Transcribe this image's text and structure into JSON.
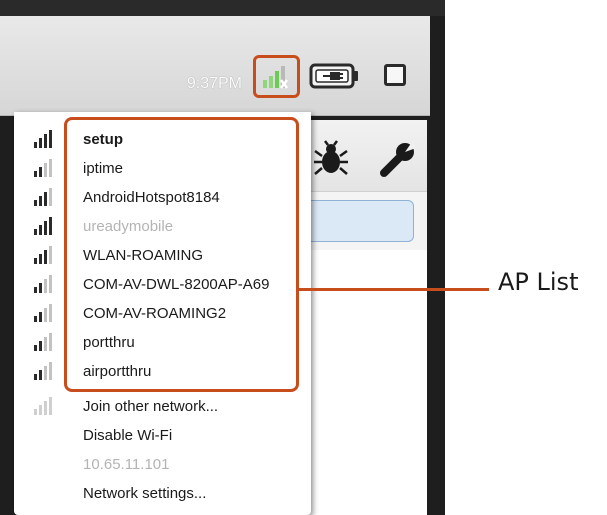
{
  "status_bar": {
    "time": "9:37PM",
    "icons": [
      "wifi-disconnected-icon",
      "battery-charging-icon",
      "square-icon"
    ]
  },
  "app": {
    "toolbar_icons": [
      "bug-icon",
      "wrench-icon"
    ]
  },
  "network_menu": {
    "networks": [
      {
        "name": "setup",
        "signal": 4,
        "bold": true
      },
      {
        "name": "iptime",
        "signal": 2
      },
      {
        "name": "AndroidHotspot8184",
        "signal": 3
      },
      {
        "name": "ureadymobile",
        "signal": 4,
        "disabled": true
      },
      {
        "name": "WLAN-ROAMING",
        "signal": 3
      },
      {
        "name": "COM-AV-DWL-8200AP-A69",
        "signal": 2
      },
      {
        "name": "COM-AV-ROAMING2",
        "signal": 2
      },
      {
        "name": "portthru",
        "signal": 2
      },
      {
        "name": "airportthru",
        "signal": 2
      }
    ],
    "actions": {
      "join_other": "Join other network...",
      "disable_wifi": "Disable Wi-Fi",
      "ip_address": "10.65.11.101",
      "network_settings": "Network settings..."
    }
  },
  "annotation": {
    "label": "AP List",
    "color": "#c84d1c"
  }
}
